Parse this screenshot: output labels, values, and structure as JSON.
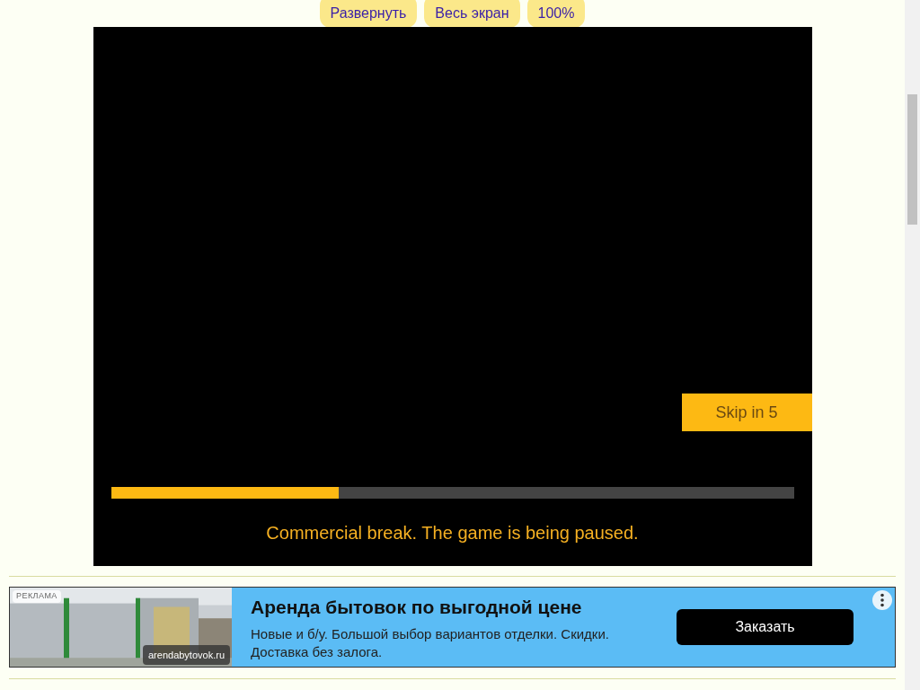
{
  "toolbar": {
    "buttons": [
      "Развернуть",
      "Весь экран",
      "100%"
    ]
  },
  "game": {
    "skip_button": "Skip in 5",
    "progress": {
      "level": 0.333
    },
    "message": "Commercial break. The game is being paused."
  },
  "ad": {
    "label": "РЕКЛАМА",
    "domain": "arendabytovok.ru",
    "title": "Аренда бытовок по выгодной цене",
    "text": "Новые и б/у. Большой выбор вариантов отделки. Скидки. Доставка без залога.",
    "button": "Заказать"
  }
}
